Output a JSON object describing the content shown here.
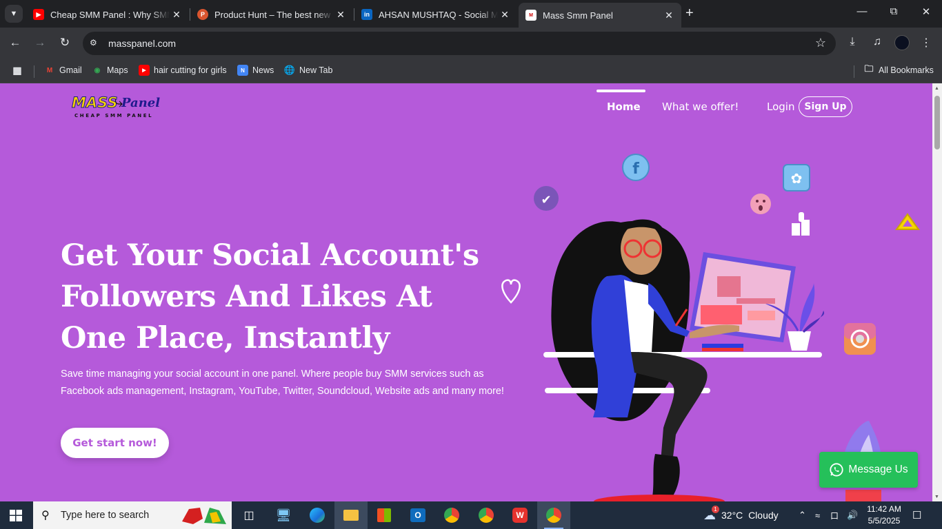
{
  "browser": {
    "tabs": [
      {
        "title": "Cheap SMM Panel : Why SMMC",
        "favicon": "youtube-icon",
        "color": "#ff0000"
      },
      {
        "title": "Product Hunt – The best new pr",
        "favicon": "producthunt-icon",
        "color": "#da552f"
      },
      {
        "title": "AHSAN MUSHTAQ - Social Med",
        "favicon": "linkedin-icon",
        "color": "#0a66c2"
      },
      {
        "title": "Mass Smm Panel",
        "favicon": "masspanel-icon",
        "color": "#ffffff"
      }
    ],
    "url": "masspanel.com",
    "bookmarks": [
      {
        "label": "Gmail",
        "icon": "gmail-icon"
      },
      {
        "label": "Maps",
        "icon": "maps-icon"
      },
      {
        "label": "hair cutting for girls",
        "icon": "youtube-icon"
      },
      {
        "label": "News",
        "icon": "news-icon"
      },
      {
        "label": "New Tab",
        "icon": "globe-icon"
      }
    ],
    "all_bookmarks": "All Bookmarks"
  },
  "site": {
    "logo": {
      "mass": "MASS",
      "panel": "Panel",
      "tagline": "CHEAP SMM PANEL"
    },
    "nav": {
      "home": "Home",
      "offer": "What we offer!",
      "login": "Login",
      "signup": "Sign Up"
    },
    "hero": {
      "title": "Get Your Social Account's Followers And Likes At One Place, Instantly",
      "subtitle": "Save time managing your social account in one panel. Where people buy SMM services such as Facebook ads management, Instagram, YouTube, Twitter, Soundcloud, Website ads and many more!",
      "cta": "Get start now!"
    },
    "message_button": "Message Us",
    "colors": {
      "background": "#b55ada",
      "whatsapp": "#25c05a"
    }
  },
  "taskbar": {
    "search_placeholder": "Type here to search",
    "weather": {
      "temp": "32°C",
      "condition": "Cloudy",
      "badge": "1"
    },
    "time": "11:42 AM",
    "date": "5/5/2025"
  }
}
